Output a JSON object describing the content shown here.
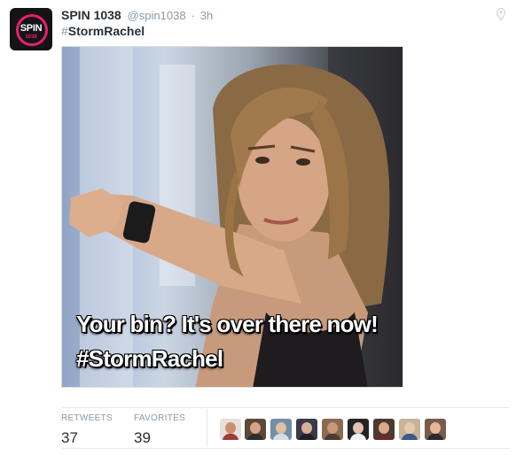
{
  "account": {
    "display_name": "SPIN 1038",
    "handle": "@spin1038",
    "separator": "·",
    "timestamp": "3h",
    "avatar_text": "SPIN",
    "avatar_subtext": "1038"
  },
  "tweet": {
    "hashtag_symbol": "#",
    "hashtag": "StormRachel"
  },
  "media": {
    "caption_line1": "Your bin? It's over there now!",
    "caption_line2": "#StormRachel"
  },
  "stats": {
    "retweets_label": "RETWEETS",
    "retweets_count": "37",
    "favorites_label": "FAVORITES",
    "favorites_count": "39"
  },
  "colors": {
    "brand_pink": "#e8206b",
    "text_dark": "#292f33",
    "text_muted": "#8899a6"
  },
  "icons": [
    "location-pin-icon"
  ],
  "favoriter_avatars": [
    {
      "name": "favoriter-avatar-1"
    },
    {
      "name": "favoriter-avatar-2"
    },
    {
      "name": "favoriter-avatar-3"
    },
    {
      "name": "favoriter-avatar-4"
    },
    {
      "name": "favoriter-avatar-5"
    },
    {
      "name": "favoriter-avatar-6"
    },
    {
      "name": "favoriter-avatar-7"
    },
    {
      "name": "favoriter-avatar-8"
    },
    {
      "name": "favoriter-avatar-9"
    }
  ]
}
